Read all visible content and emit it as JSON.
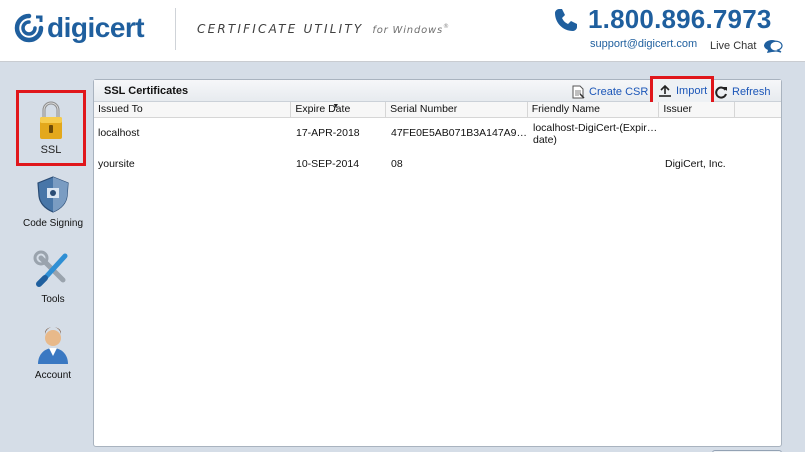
{
  "header": {
    "logo_text": "digicert",
    "product_title": "CERTIFICATE UTILITY",
    "product_subtitle": "for Windows",
    "product_mark": "®",
    "phone": "1.800.896.7973",
    "support_email": "support@digicert.com",
    "live_chat_label": "Live Chat",
    "brand_color": "#1f5f9e"
  },
  "sidebar": {
    "items": [
      {
        "label": "SSL",
        "icon": "lock-icon",
        "selected": true
      },
      {
        "label": "Code Signing",
        "icon": "shield-icon"
      },
      {
        "label": "Tools",
        "icon": "tools-icon"
      },
      {
        "label": "Account",
        "icon": "user-icon"
      }
    ]
  },
  "panel": {
    "title": "SSL Certificates",
    "toolbar": {
      "create_csr": "Create CSR",
      "import": "Import",
      "refresh": "Refresh"
    },
    "columns": [
      "Issued To",
      "Expire Date",
      "Serial Number",
      "Friendly Name",
      "Issuer",
      ""
    ],
    "sorted_column": "Expire Date",
    "rows": [
      {
        "issued_to": "localhost",
        "expire_date": "17-APR-2018",
        "serial": "47FE0E5AB071B3A147A9…",
        "friendly_line1": "localhost-DigiCert-(Expir…",
        "friendly_line2": "date)",
        "issuer": ""
      },
      {
        "issued_to": "yoursite",
        "expire_date": "10-SEP-2014",
        "serial": "08",
        "friendly_line1": "",
        "friendly_line2": "",
        "issuer": "DigiCert, Inc."
      }
    ]
  },
  "highlight_color": "#e0161b"
}
